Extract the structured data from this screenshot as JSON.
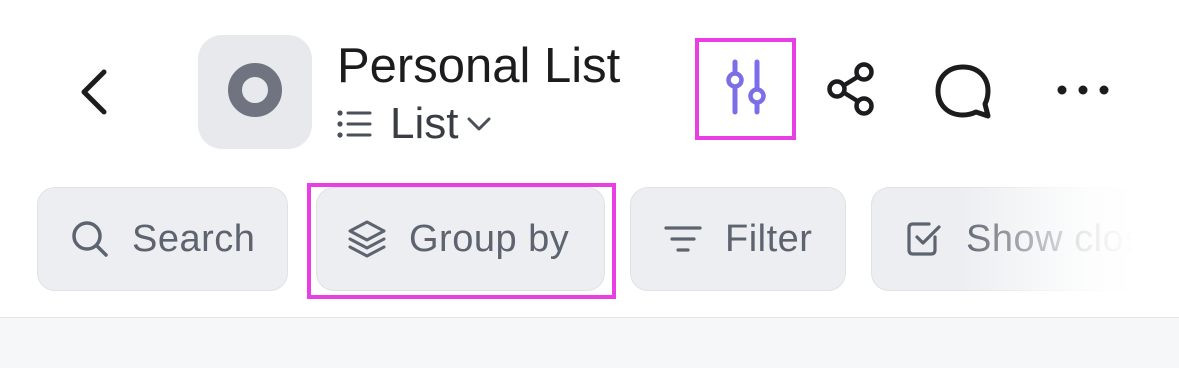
{
  "header": {
    "title": "Personal List",
    "view_label": "List"
  },
  "icons": {
    "back": "chevron-left-icon",
    "list_avatar": "ring-icon",
    "view": "list-bullets-icon",
    "view_chevron": "chevron-down-icon",
    "settings": "sliders-icon",
    "share": "share-icon",
    "comment": "comment-bubble-icon",
    "more": "more-horizontal-icon"
  },
  "toolbar": {
    "chips": [
      {
        "label": "Search",
        "icon": "search-icon"
      },
      {
        "label": "Group by",
        "icon": "layers-icon"
      },
      {
        "label": "Filter",
        "icon": "filter-lines-icon"
      },
      {
        "label": "Show closed",
        "icon": "checkbox-icon"
      }
    ]
  },
  "colors": {
    "accent_purple": "#7b6ee8",
    "highlight_magenta": "#e83ee4",
    "chip_bg": "#eceef1",
    "text_dark": "#1c1c1e",
    "text_muted": "#5d6470"
  }
}
